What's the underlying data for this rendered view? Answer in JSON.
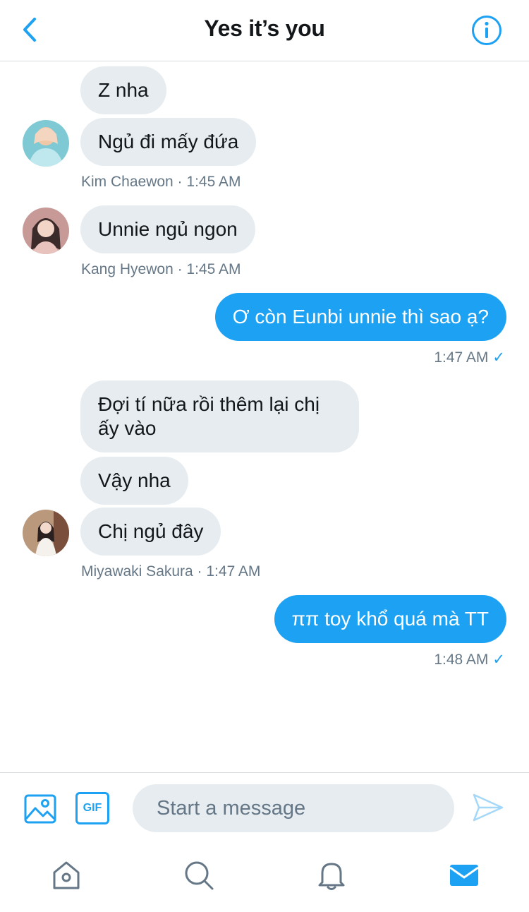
{
  "header": {
    "title": "Yes it’s you",
    "back_icon": "chevron-left-icon",
    "info_icon": "info-icon"
  },
  "colors": {
    "accent": "#1da1f2",
    "incoming_bubble": "#e6ecf0",
    "meta_text": "#657786"
  },
  "messages": [
    {
      "direction": "incoming",
      "text": "Z nha"
    },
    {
      "direction": "incoming",
      "text": "Ngủ đi mấy đứa"
    },
    {
      "meta": "Kim Chaewon · 1:45 AM"
    },
    {
      "direction": "incoming",
      "text": "Unnie ngủ ngon"
    },
    {
      "meta": "Kang Hyewon · 1:45 AM"
    },
    {
      "direction": "outgoing",
      "text": "Ơ còn Eunbi unnie thì sao ạ?"
    },
    {
      "meta": "1:47 AM",
      "status": "✓"
    },
    {
      "direction": "incoming",
      "text": "Đợi tí nữa rồi thêm lại chị ấy vào"
    },
    {
      "direction": "incoming",
      "text": "Vậy nha"
    },
    {
      "direction": "incoming",
      "text": "Chị ngủ đây"
    },
    {
      "meta": "Miyawaki Sakura · 1:47 AM"
    },
    {
      "direction": "outgoing",
      "text": "ππ toy khổ quá mà TT"
    },
    {
      "meta": "1:48 AM",
      "status": "✓"
    }
  ],
  "composer": {
    "placeholder": "Start a message",
    "gif_label": "GIF",
    "image_icon": "image-icon",
    "send_icon": "send-icon"
  },
  "tabbar": {
    "items": [
      "home-icon",
      "search-icon",
      "notifications-icon",
      "messages-icon"
    ],
    "active": "messages-icon"
  }
}
